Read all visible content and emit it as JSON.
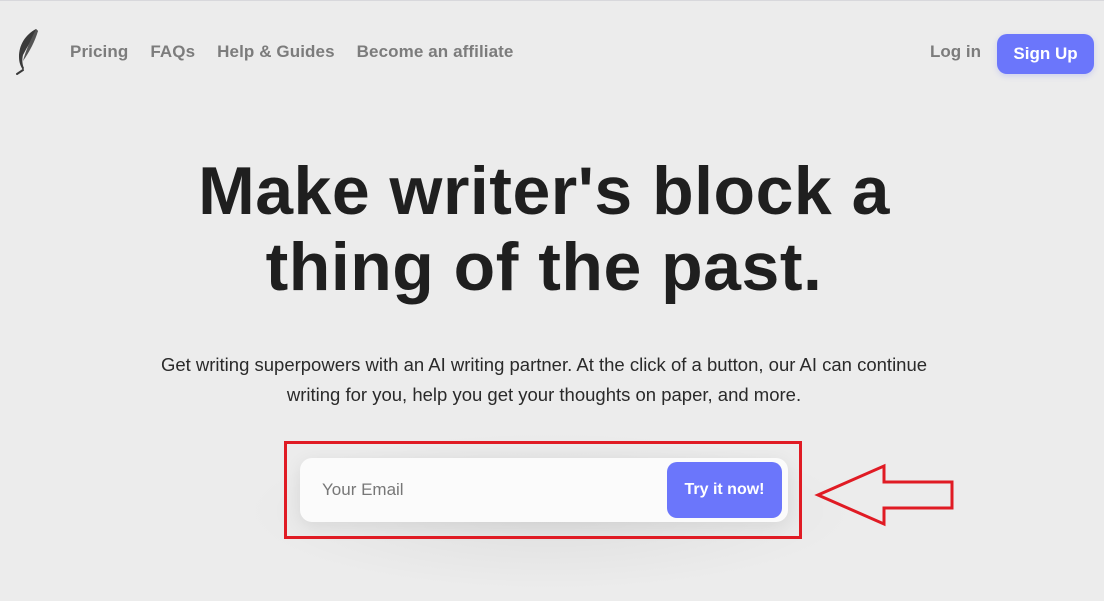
{
  "header": {
    "nav": [
      {
        "label": "Pricing"
      },
      {
        "label": "FAQs"
      },
      {
        "label": "Help & Guides"
      },
      {
        "label": "Become an affiliate"
      }
    ],
    "login_label": "Log in",
    "signup_label": "Sign Up"
  },
  "hero": {
    "headline_line1": "Make writer's block a",
    "headline_line2": "thing of the past.",
    "subtext_line1": "Get writing superpowers with an AI writing partner. At the click of a button, our AI can continue",
    "subtext_line2": "writing for you, help you get your thoughts on paper, and more."
  },
  "signup_form": {
    "email_placeholder": "Your Email",
    "email_value": "",
    "cta_label": "Try it now!"
  },
  "annotation": {
    "highlight_color": "#e01b24",
    "arrow_icon": "left-arrow-outline"
  },
  "colors": {
    "accent": "#6b76fb",
    "background": "#ececec",
    "text_dark": "#1f1f1f",
    "nav_gray": "#7c7c7c"
  }
}
